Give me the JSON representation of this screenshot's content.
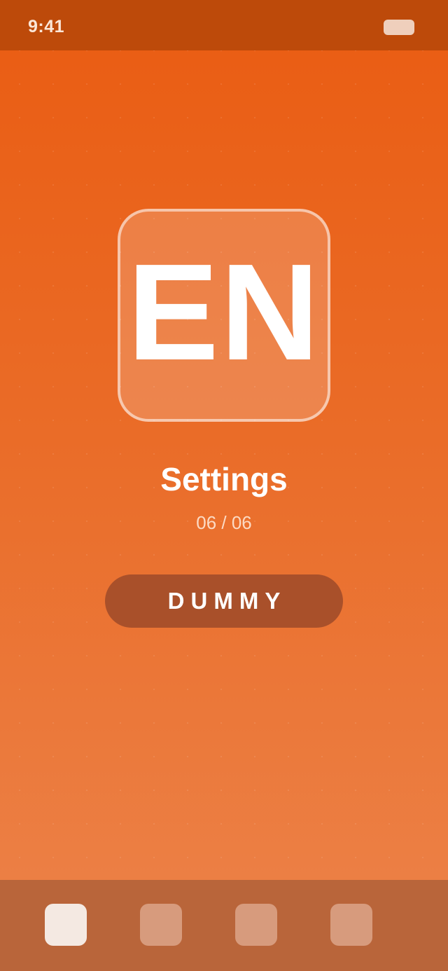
{
  "status_bar": {
    "time": "9:41",
    "battery_icon": "battery-icon"
  },
  "logo": {
    "text": "EN"
  },
  "page": {
    "title": "Settings",
    "counter": "06 / 06"
  },
  "cta": {
    "label": "DUMMY"
  },
  "tab_bar": {
    "tabs": [
      {
        "icon": "tab-icon-1",
        "active": true
      },
      {
        "icon": "tab-icon-2",
        "active": false
      },
      {
        "icon": "tab-icon-3",
        "active": false
      },
      {
        "icon": "tab-icon-4",
        "active": false
      }
    ]
  },
  "colors": {
    "status_bar": "#bd4a0a",
    "background_top": "#ea5c12",
    "background_bottom": "#ec834a",
    "button": "#a9502a",
    "tab_bar": "#b9653a",
    "tab_active": "#f4e9e2"
  }
}
